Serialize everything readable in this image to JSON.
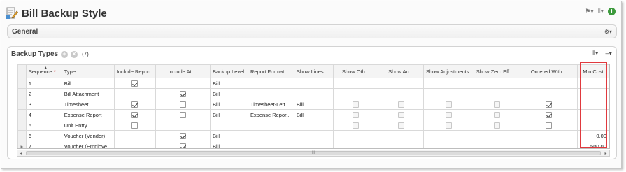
{
  "window": {
    "title": "Bill Backup Style"
  },
  "general": {
    "label": "General"
  },
  "backup_types": {
    "label": "Backup Types",
    "count": "(7)",
    "columns": [
      "Sequence",
      "Type",
      "Include Report",
      "Include Att...",
      "Backup Level",
      "Report Format",
      "Show Lines",
      "Show Oth...",
      "Show Au...",
      "Show Adjustments",
      "Show Zero Eff...",
      "Ordered With...",
      "Min Cost"
    ],
    "required_marker": "*",
    "rows": [
      {
        "seq": "1",
        "type": "Bill",
        "include_report": true,
        "include_att": null,
        "level": "Bill",
        "format": "",
        "lines": "",
        "oth": null,
        "au": null,
        "adj": null,
        "zero": null,
        "ordered": null,
        "min_cost": ""
      },
      {
        "seq": "2",
        "type": "Bill Attachment",
        "include_report": null,
        "include_att": true,
        "level": "Bill",
        "format": "",
        "lines": "",
        "oth": null,
        "au": null,
        "adj": null,
        "zero": null,
        "ordered": null,
        "min_cost": ""
      },
      {
        "seq": "3",
        "type": "Timesheet",
        "include_report": true,
        "include_att": false,
        "level": "Bill",
        "format": "Timesheet-Lett...",
        "lines": "Bill",
        "oth": false,
        "au": false,
        "adj": false,
        "zero": false,
        "ordered": true,
        "min_cost": ""
      },
      {
        "seq": "4",
        "type": "Expense Report",
        "include_report": true,
        "include_att": false,
        "level": "Bill",
        "format": "Expense Repor...",
        "lines": "Bill",
        "oth": false,
        "au": false,
        "adj": false,
        "zero": false,
        "ordered": true,
        "min_cost": ""
      },
      {
        "seq": "5",
        "type": "Unit Entry",
        "include_report": false,
        "include_att": null,
        "level": "",
        "format": "",
        "lines": "",
        "oth": false,
        "au": false,
        "adj": false,
        "zero": false,
        "ordered": false,
        "min_cost": ""
      },
      {
        "seq": "6",
        "type": "Voucher (Vendor)",
        "include_report": null,
        "include_att": true,
        "level": "Bill",
        "format": "",
        "lines": "",
        "oth": null,
        "au": null,
        "adj": null,
        "zero": null,
        "ordered": null,
        "min_cost": "0.00"
      },
      {
        "seq": "7",
        "type": "Voucher (Employe...",
        "include_report": null,
        "include_att": true,
        "level": "Bill",
        "format": "",
        "lines": "",
        "oth": null,
        "au": null,
        "adj": null,
        "zero": null,
        "ordered": null,
        "min_cost": "500.00"
      }
    ],
    "scroll_grip": "III"
  },
  "icons": {
    "title": "document-edit-icon",
    "flag": "flag-icon",
    "columns": "column-chooser-icon",
    "info": "info-icon",
    "add": "add-icon",
    "remove": "remove-icon",
    "panel_menu": "panel-menu-icon"
  },
  "colors": {
    "highlight": "#e0393e",
    "info": "#3c9a3c",
    "required": "#d02020"
  }
}
